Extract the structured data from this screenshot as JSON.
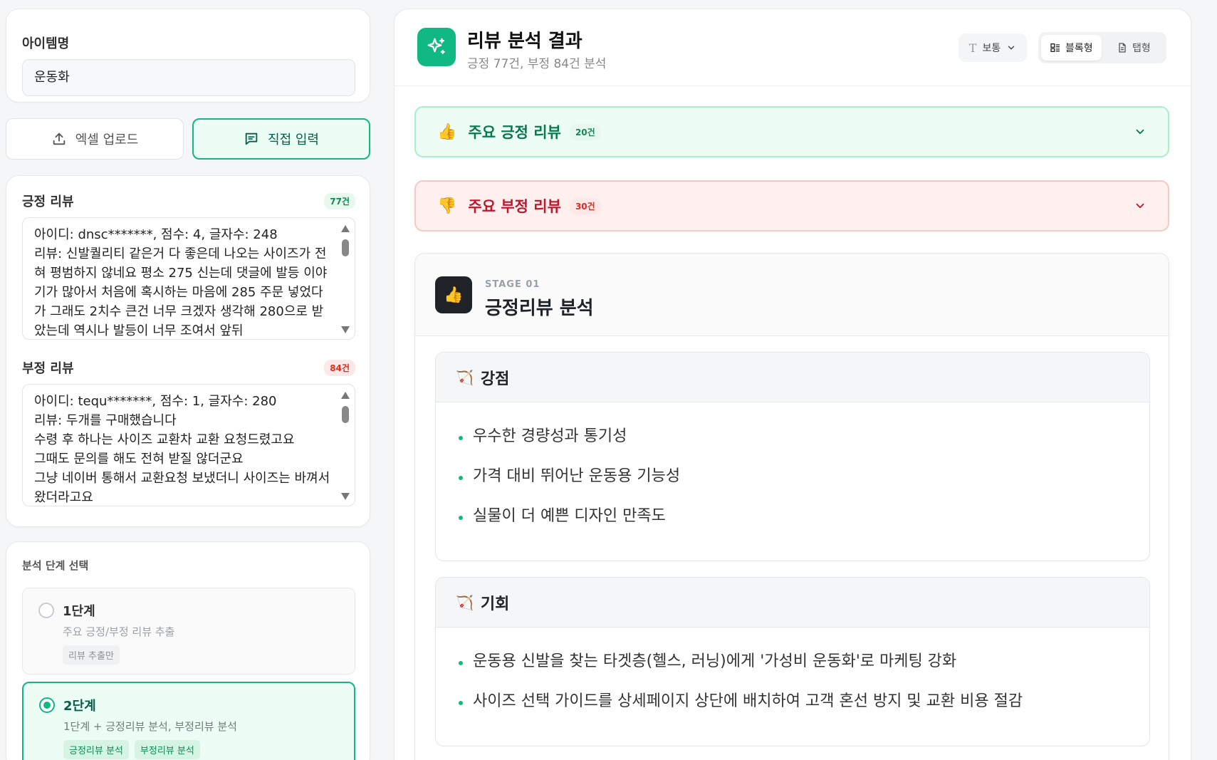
{
  "item": {
    "label": "아이템명",
    "value": "운동화"
  },
  "input_mode": {
    "upload_label": "엑셀 업로드",
    "direct_label": "직접 입력"
  },
  "positive_reviews": {
    "label": "긍정 리뷰",
    "count": "77건",
    "text": "아이디: dnsc*******, 점수: 4, 글자수: 248\n리뷰: 신발퀄리티 같은거 다 좋은데 나오는 사이즈가 전혀 평범하지 않네요 평소 275 신는데 댓글에 발등 이야기가 많아서 처음에 혹시하는 마음에 285 주문 넣었다가 그래도 2치수 큰건 너무 크겠자 생각해 280으로 받았는데 역시나 발등이 너무 조여서 앞뒤"
  },
  "negative_reviews": {
    "label": "부정 리뷰",
    "count": "84건",
    "text": "아이디: tequ*******, 점수: 1, 글자수: 280\n리뷰: 두개를 구매했습니다\n수령 후 하나는 사이즈 교환차 교환 요청드렸고요\n그때도 문의를 해도 전혀 받질 않더군요\n그냥 네이버 통해서 교환요청 보냈더니 사이즈는 바껴서 왔더라고요"
  },
  "stage_select": {
    "label": "분석 단계 선택",
    "stage1": {
      "title": "1단계",
      "desc": "주요 긍정/부정 리뷰 추출",
      "tags": [
        "리뷰 추출만"
      ],
      "selected": false
    },
    "stage2": {
      "title": "2단계",
      "desc": "1단계 + 긍정리뷰 분석, 부정리뷰 분석",
      "tags": [
        "긍정리뷰 분석",
        "부정리뷰 분석"
      ],
      "selected": true
    }
  },
  "result": {
    "title": "리뷰 분석 결과",
    "subtitle": "긍정 77건, 부정 84건 분석",
    "font_size_label": "보통",
    "view_block_label": "블록형",
    "view_tab_label": "탭형",
    "accent_color": "#10b981",
    "positive_section": {
      "emoji": "👍",
      "title": "주요 긍정 리뷰",
      "count": "20건"
    },
    "negative_section": {
      "emoji": "👎",
      "title": "주요 부정 리뷰",
      "count": "30건"
    },
    "stage": {
      "emoji": "👍",
      "kicker": "STAGE 01",
      "title": "긍정리뷰 분석",
      "strengths": {
        "emoji": "🏹",
        "title": "강점",
        "items": [
          "우수한 경량성과 통기성",
          "가격 대비 뛰어난 운동용 기능성",
          "실물이 더 예쁜 디자인 만족도"
        ]
      },
      "opportunities": {
        "emoji": "🏹",
        "title": "기회",
        "items": [
          "운동용 신발을 찾는 타겟층(헬스, 러닝)에게 '가성비 운동화'로 마케팅 강화",
          "사이즈 선택 가이드를 상세페이지 상단에 배치하여 고객 혼선 방지 및 교환 비용 절감"
        ]
      }
    }
  }
}
